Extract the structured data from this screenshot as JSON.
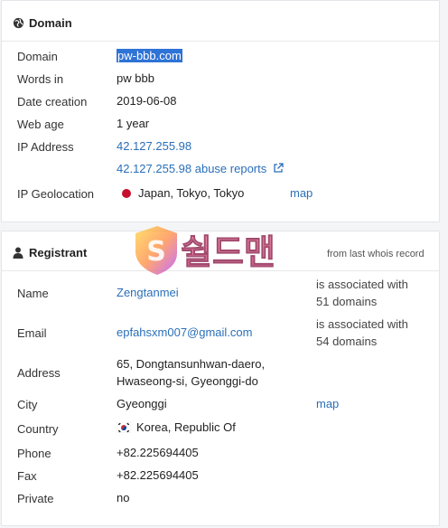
{
  "domain_section": {
    "title": "Domain",
    "rows": {
      "domain_label": "Domain",
      "domain_value": "pw-bbb.com",
      "words_label": "Words in",
      "words_value": "pw bbb",
      "created_label": "Date creation",
      "created_value": "2019-06-08",
      "age_label": "Web age",
      "age_value": "1 year",
      "ip_label": "IP Address",
      "ip_value": "42.127.255.98",
      "abuse_link": "42.127.255.98 abuse reports",
      "geo_label": "IP Geolocation",
      "geo_value": "Japan, Tokyo, Tokyo",
      "geo_map_link": "map"
    }
  },
  "registrant_section": {
    "title": "Registrant",
    "source_note": "from last whois record",
    "name_label": "Name",
    "name_value": "Zengtanmei",
    "name_assoc_1": "is associated with",
    "name_assoc_2": "51 domains",
    "email_label": "Email",
    "email_value": "epfahsxm007@gmail.com",
    "email_assoc_1": "is associated with",
    "email_assoc_2": "54 domains",
    "address_label": "Address",
    "address_line1": "65, Dongtansunhwan-daero,",
    "address_line2": "Hwaseong-si, Gyeonggi-do",
    "city_label": "City",
    "city_value": "Gyeonggi",
    "city_map_link": "map",
    "country_label": "Country",
    "country_value": "Korea, Republic Of",
    "phone_label": "Phone",
    "phone_value": "+82.225694405",
    "fax_label": "Fax",
    "fax_value": "+82.225694405",
    "private_label": "Private",
    "private_value": "no"
  },
  "watermark": {
    "text": "쉴드맨",
    "letter": "S"
  },
  "colors": {
    "link": "#2a6fb8",
    "highlight": "#2e73d6",
    "japan_dot": "#c4102d"
  },
  "icons": {
    "domain_title": "globe-icon",
    "registrant_title": "user-icon",
    "abuse": "external-link-icon",
    "country_flag": "korea-flag-icon"
  }
}
